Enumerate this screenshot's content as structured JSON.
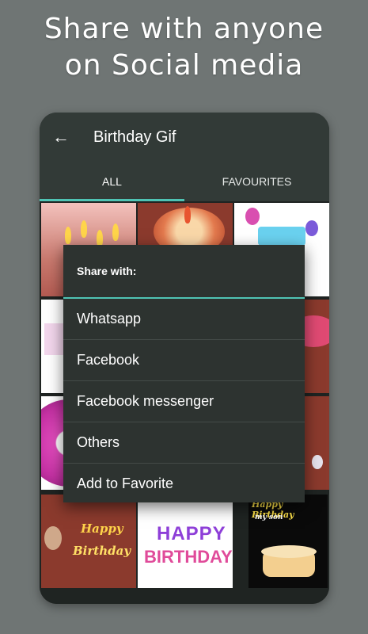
{
  "promo": {
    "line1": "Share with anyone",
    "line2": "on Social media"
  },
  "appbar": {
    "back_icon": "arrow-left-icon",
    "title": "Birthday Gif"
  },
  "tabs": [
    {
      "label": "ALL",
      "selected": true
    },
    {
      "label": "FAVOURITES",
      "selected": false
    }
  ],
  "grid": {
    "thumb_text": [
      "Happy",
      "Birthday",
      "HAPPY",
      "BIRTHDAY",
      "Happy Birthday",
      "my son"
    ]
  },
  "share_dialog": {
    "title": "Share with:",
    "options": [
      "Whatsapp",
      "Facebook",
      "Facebook messenger",
      "Others",
      "Add to Favorite"
    ]
  },
  "colors": {
    "background": "#6f7574",
    "appbar": "#323a37",
    "accent": "#4fc3b4",
    "dialog": "#2d3330"
  }
}
